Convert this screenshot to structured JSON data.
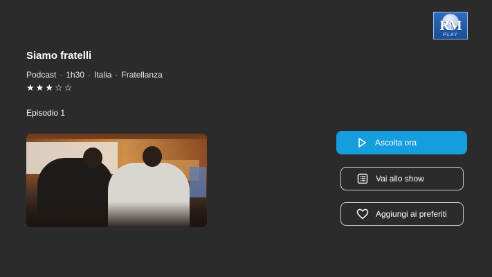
{
  "logo": {
    "brand_text": "RM",
    "sub_text": "PLAY",
    "icon": "rm-play-logo"
  },
  "podcast": {
    "title": "Siamo fratelli",
    "meta": [
      "Podcast",
      "1h30",
      "Italia",
      "Fratellanza"
    ],
    "meta_separator": "·",
    "rating": {
      "value": 3,
      "max": 5
    }
  },
  "episode": {
    "label": "Episodio 1",
    "thumbnail": "episode-thumbnail-image"
  },
  "actions": {
    "listen": {
      "label": "Ascolta ora",
      "icon": "play-icon",
      "color": "#169ddd"
    },
    "show": {
      "label": "Vai allo show",
      "icon": "list-icon"
    },
    "favorite": {
      "label": "Aggiungi ai preferiti",
      "icon": "heart-icon"
    }
  },
  "colors": {
    "background": "#2b2b2b",
    "accent": "#169ddd",
    "text": "#ffffff"
  }
}
